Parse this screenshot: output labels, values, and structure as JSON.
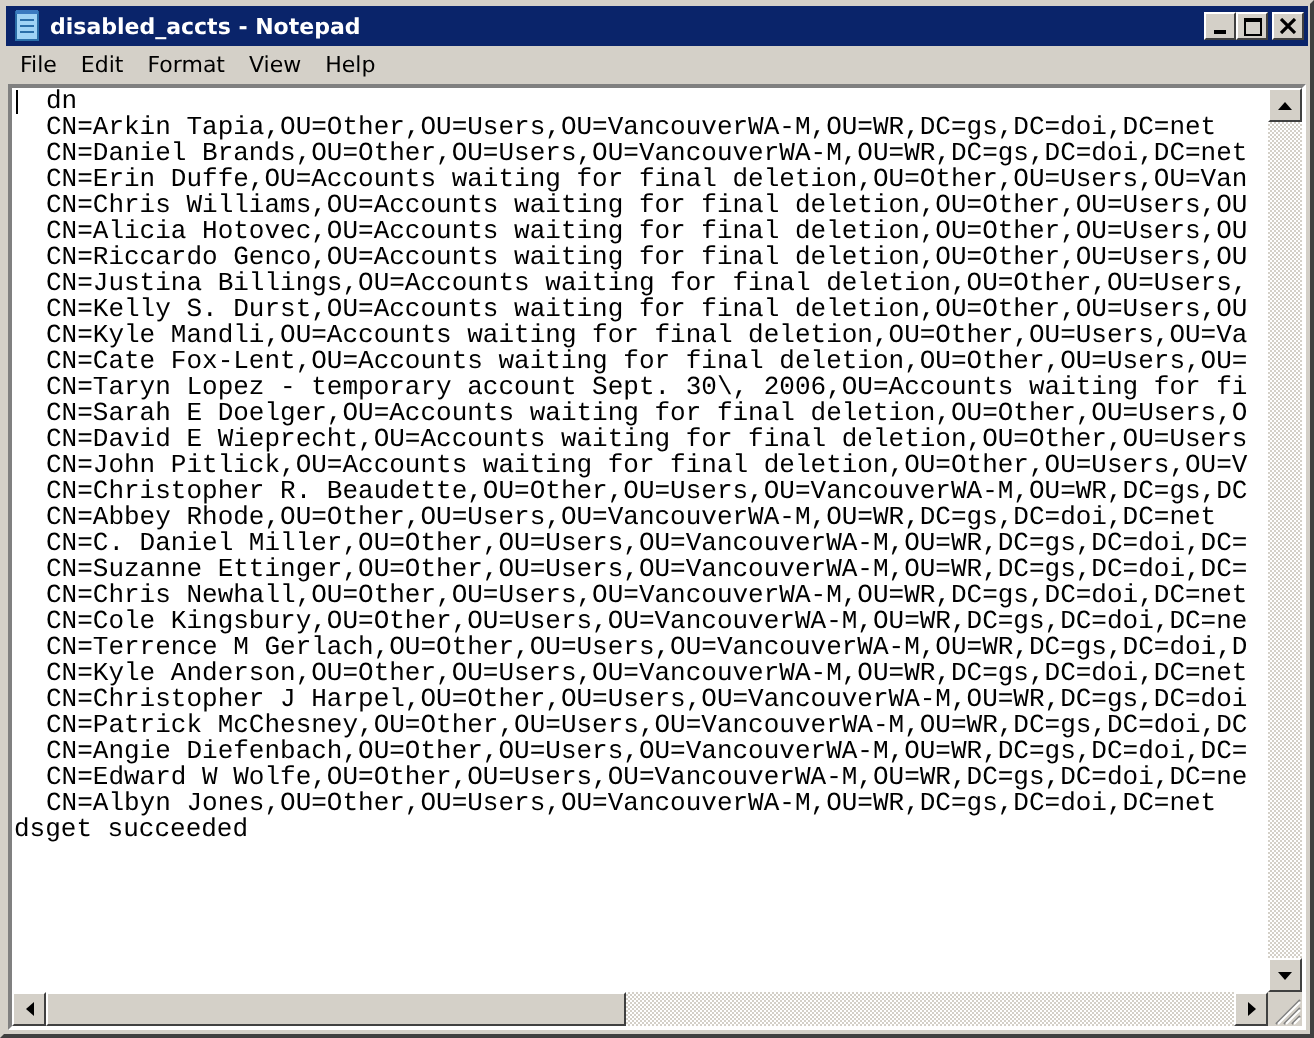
{
  "window": {
    "title": "disabled_accts - Notepad"
  },
  "menu": [
    "File",
    "Edit",
    "Format",
    "View",
    "Help"
  ],
  "document": {
    "lines": [
      {
        "kind": "indented",
        "text": "dn"
      },
      {
        "kind": "indented",
        "text": "CN=Arkin Tapia,OU=Other,OU=Users,OU=VancouverWA-M,OU=WR,DC=gs,DC=doi,DC=net"
      },
      {
        "kind": "indented",
        "text": "CN=Daniel Brands,OU=Other,OU=Users,OU=VancouverWA-M,OU=WR,DC=gs,DC=doi,DC=net"
      },
      {
        "kind": "indented",
        "text": "CN=Erin Duffe,OU=Accounts waiting for final deletion,OU=Other,OU=Users,OU=Van"
      },
      {
        "kind": "indented",
        "text": "CN=Chris Williams,OU=Accounts waiting for final deletion,OU=Other,OU=Users,OU"
      },
      {
        "kind": "indented",
        "text": "CN=Alicia Hotovec,OU=Accounts waiting for final deletion,OU=Other,OU=Users,OU"
      },
      {
        "kind": "indented",
        "text": "CN=Riccardo Genco,OU=Accounts waiting for final deletion,OU=Other,OU=Users,OU"
      },
      {
        "kind": "indented",
        "text": "CN=Justina Billings,OU=Accounts waiting for final deletion,OU=Other,OU=Users,"
      },
      {
        "kind": "indented",
        "text": "CN=Kelly S. Durst,OU=Accounts waiting for final deletion,OU=Other,OU=Users,OU"
      },
      {
        "kind": "indented",
        "text": "CN=Kyle Mandli,OU=Accounts waiting for final deletion,OU=Other,OU=Users,OU=Va"
      },
      {
        "kind": "indented",
        "text": "CN=Cate Fox-Lent,OU=Accounts waiting for final deletion,OU=Other,OU=Users,OU="
      },
      {
        "kind": "indented",
        "text": "CN=Taryn Lopez - temporary account Sept. 30\\, 2006,OU=Accounts waiting for fi"
      },
      {
        "kind": "indented",
        "text": "CN=Sarah E Doelger,OU=Accounts waiting for final deletion,OU=Other,OU=Users,O"
      },
      {
        "kind": "indented",
        "text": "CN=David E Wieprecht,OU=Accounts waiting for final deletion,OU=Other,OU=Users"
      },
      {
        "kind": "indented",
        "text": "CN=John Pitlick,OU=Accounts waiting for final deletion,OU=Other,OU=Users,OU=V"
      },
      {
        "kind": "indented",
        "text": "CN=Christopher R. Beaudette,OU=Other,OU=Users,OU=VancouverWA-M,OU=WR,DC=gs,DC"
      },
      {
        "kind": "indented",
        "text": "CN=Abbey Rhode,OU=Other,OU=Users,OU=VancouverWA-M,OU=WR,DC=gs,DC=doi,DC=net"
      },
      {
        "kind": "indented",
        "text": "CN=C. Daniel Miller,OU=Other,OU=Users,OU=VancouverWA-M,OU=WR,DC=gs,DC=doi,DC="
      },
      {
        "kind": "indented",
        "text": "CN=Suzanne Ettinger,OU=Other,OU=Users,OU=VancouverWA-M,OU=WR,DC=gs,DC=doi,DC="
      },
      {
        "kind": "indented",
        "text": "CN=Chris Newhall,OU=Other,OU=Users,OU=VancouverWA-M,OU=WR,DC=gs,DC=doi,DC=net"
      },
      {
        "kind": "indented",
        "text": "CN=Cole Kingsbury,OU=Other,OU=Users,OU=VancouverWA-M,OU=WR,DC=gs,DC=doi,DC=ne"
      },
      {
        "kind": "indented",
        "text": "CN=Terrence M Gerlach,OU=Other,OU=Users,OU=VancouverWA-M,OU=WR,DC=gs,DC=doi,D"
      },
      {
        "kind": "indented",
        "text": "CN=Kyle Anderson,OU=Other,OU=Users,OU=VancouverWA-M,OU=WR,DC=gs,DC=doi,DC=net"
      },
      {
        "kind": "indented",
        "text": "CN=Christopher J Harpel,OU=Other,OU=Users,OU=VancouverWA-M,OU=WR,DC=gs,DC=doi"
      },
      {
        "kind": "indented",
        "text": "CN=Patrick McChesney,OU=Other,OU=Users,OU=VancouverWA-M,OU=WR,DC=gs,DC=doi,DC"
      },
      {
        "kind": "indented",
        "text": "CN=Angie Diefenbach,OU=Other,OU=Users,OU=VancouverWA-M,OU=WR,DC=gs,DC=doi,DC="
      },
      {
        "kind": "indented",
        "text": "CN=Edward W Wolfe,OU=Other,OU=Users,OU=VancouverWA-M,OU=WR,DC=gs,DC=doi,DC=ne"
      },
      {
        "kind": "indented",
        "text": "CN=Albyn Jones,OU=Other,OU=Users,OU=VancouverWA-M,OU=WR,DC=gs,DC=doi,DC=net"
      },
      {
        "kind": "plain",
        "text": "dsget succeeded"
      }
    ]
  }
}
